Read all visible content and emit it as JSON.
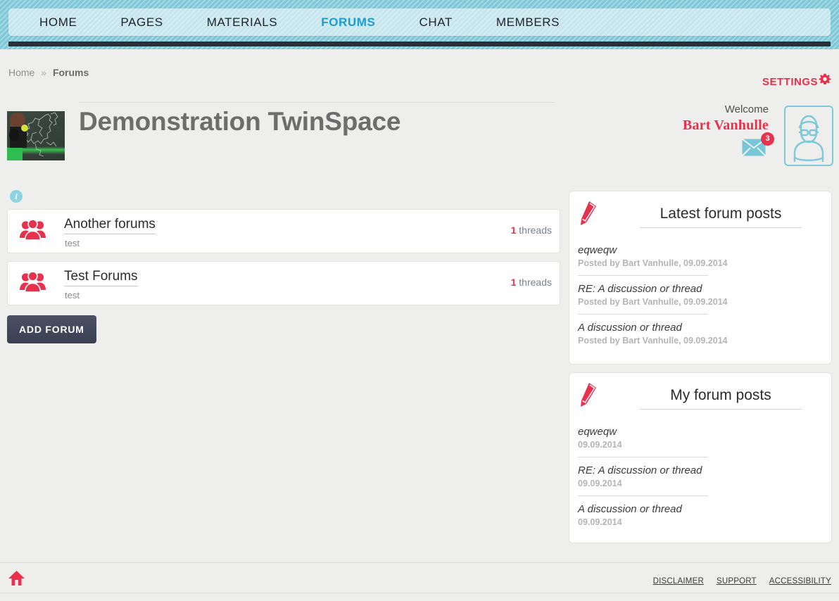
{
  "theme": {
    "nav_bg": "#7ec8d8",
    "accent_red": "#e8314d",
    "accent_blue": "#1a9dd0",
    "page_bg": "#eeeeec",
    "title_gray": "#6d6d6d",
    "button_dark": "#3b3f52"
  },
  "nav": {
    "items": [
      {
        "label": "HOME",
        "active": false
      },
      {
        "label": "PAGES",
        "active": false
      },
      {
        "label": "MATERIALS",
        "active": false
      },
      {
        "label": "FORUMS",
        "active": true
      },
      {
        "label": "CHAT",
        "active": false
      },
      {
        "label": "MEMBERS",
        "active": false
      }
    ]
  },
  "breadcrumb": {
    "home": "Home",
    "separator": "»",
    "current": "Forums"
  },
  "settings": {
    "label": "SETTINGS",
    "icon": "gear-icon"
  },
  "header": {
    "title": "Demonstration TwinSpace",
    "thumbnail_alt": "twinspace-thumbnail"
  },
  "user": {
    "welcome_label": "Welcome",
    "name": "Bart Vanhulle",
    "mail_icon": "envelope-icon",
    "mail_badge": "3",
    "avatar_icon": "user-avatar-icon"
  },
  "main": {
    "info_icon": "info-icon",
    "forums": [
      {
        "icon": "group-icon",
        "name": "Another forums",
        "description": "test",
        "thread_count": "1",
        "thread_label": "threads"
      },
      {
        "icon": "group-icon",
        "name": "Test Forums",
        "description": "test",
        "thread_count": "1",
        "thread_label": "threads"
      }
    ],
    "add_forum_label": "ADD FORUM"
  },
  "panels": [
    {
      "icon": "pencil-icon",
      "title": "Latest forum posts",
      "posts": [
        {
          "title": "eqweqw",
          "meta": "Posted by Bart Vanhulle, 09.09.2014"
        },
        {
          "title": "RE: A discussion or thread",
          "meta": "Posted by Bart Vanhulle, 09.09.2014"
        },
        {
          "title": "A discussion or thread",
          "meta": "Posted by Bart Vanhulle, 09.09.2014"
        }
      ]
    },
    {
      "icon": "pencil-icon",
      "title": "My forum posts",
      "posts": [
        {
          "title": "eqweqw",
          "meta": "09.09.2014"
        },
        {
          "title": "RE: A discussion or thread",
          "meta": "09.09.2014"
        },
        {
          "title": "A discussion or thread",
          "meta": "09.09.2014"
        }
      ]
    }
  ],
  "footer": {
    "home_icon": "home-icon",
    "links": [
      {
        "label": "DISCLAIMER"
      },
      {
        "label": "SUPPORT"
      },
      {
        "label": "ACCESSIBILITY"
      }
    ]
  }
}
